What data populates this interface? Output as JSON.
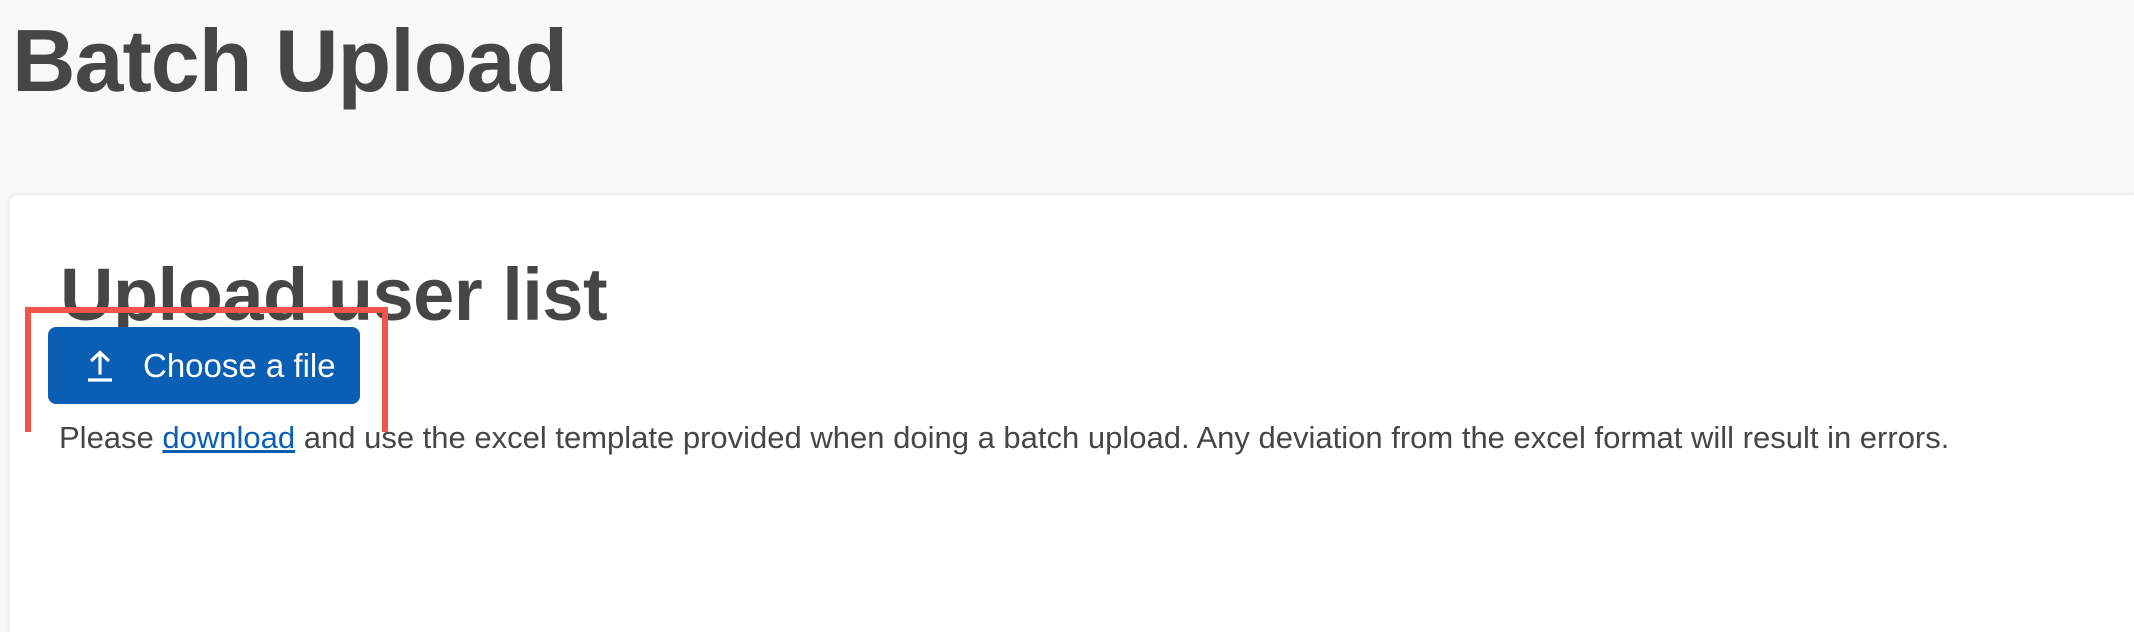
{
  "header": {
    "title": "Batch Upload"
  },
  "card": {
    "title": "Upload user list",
    "instructions": {
      "prefix": "Please ",
      "link_text": "download",
      "suffix": " and use the excel template provided when doing a batch upload. Any deviation from the excel format will result in errors."
    },
    "upload_button": {
      "label": "Choose a file",
      "icon": "upload-icon"
    }
  },
  "colors": {
    "primary": "#0a5fb4",
    "text": "#464646",
    "highlight": "#f0544c",
    "background": "#f8f8f8",
    "card": "#ffffff"
  }
}
